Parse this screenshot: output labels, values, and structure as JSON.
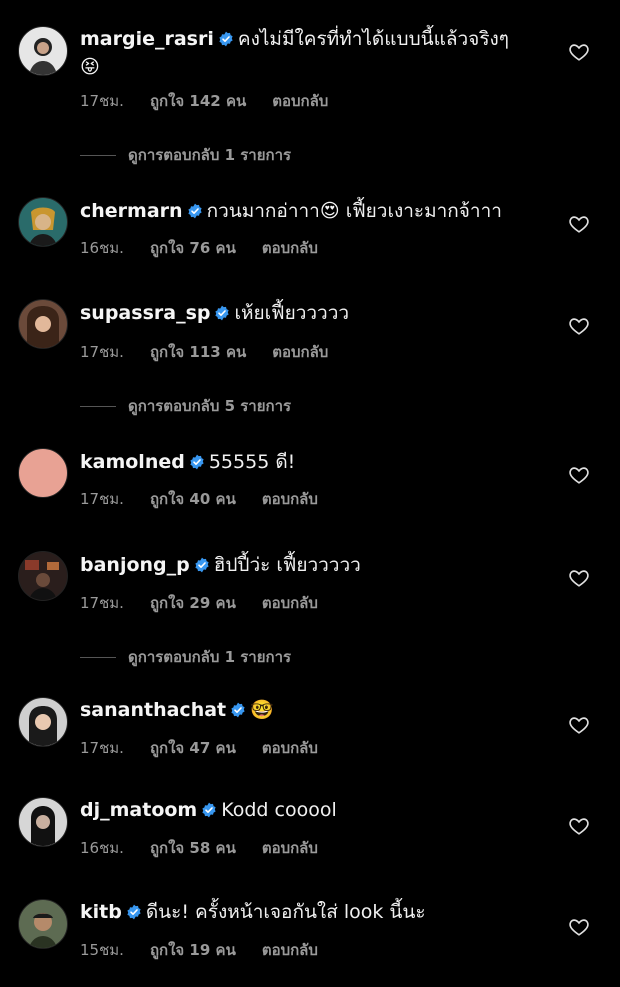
{
  "comments": [
    {
      "username": "margie_rasri",
      "text": "คงไม่มีใครที่ทำได้แบบนี้แล้วจริงๆ",
      "emoji": "😝",
      "time": "17ชม.",
      "likes": "ถูกใจ 142 คน",
      "reply": "ตอบกลับ",
      "avatar_color": "#d9d9d9"
    },
    {
      "username": "chermarn",
      "text": "กวนมากอ่าาา",
      "emoji": "😍",
      "text2": "เฟี้ยวเงาะมากจ้าาา",
      "time": "16ชม.",
      "likes": "ถูกใจ 76 คน",
      "reply": "ตอบกลับ",
      "avatar_color": "#2a6b6a"
    },
    {
      "username": "supassra_sp",
      "text": "เห้ยเฟี้ยววววว",
      "time": "17ชม.",
      "likes": "ถูกใจ 113 คน",
      "reply": "ตอบกลับ",
      "avatar_color": "#6b4a3a"
    },
    {
      "username": "kamolned",
      "text": "55555 ดี!",
      "time": "17ชม.",
      "likes": "ถูกใจ 40 คน",
      "reply": "ตอบกลับ",
      "avatar_color": "#e8a294"
    },
    {
      "username": "banjong_p",
      "text": "ฮิปปี้ว่ะ เฟี้ยววววว",
      "time": "17ชม.",
      "likes": "ถูกใจ 29 คน",
      "reply": "ตอบกลับ",
      "avatar_color": "#3a2a26"
    },
    {
      "username": "sananthachat",
      "text": "",
      "emoji": "🤓",
      "time": "17ชม.",
      "likes": "ถูกใจ 47 คน",
      "reply": "ตอบกลับ",
      "avatar_color": "#4a4a4a"
    },
    {
      "username": "dj_matoom",
      "text": "Kodd cooool",
      "time": "16ชม.",
      "likes": "ถูกใจ 58 คน",
      "reply": "ตอบกลับ",
      "avatar_color": "#2b2b2b"
    },
    {
      "username": "kitb",
      "text": "ดีนะ! ครั้งหน้าเจอกันใส่ look นี้นะ",
      "time": "15ชม.",
      "likes": "ถูกใจ 19 คน",
      "reply": "ตอบกลับ",
      "avatar_color": "#5d6b52"
    }
  ],
  "view_replies": [
    {
      "label": "ดูการตอบกลับ 1 รายการ"
    },
    {
      "label": "ดูการตอบกลับ 5 รายการ"
    },
    {
      "label": "ดูการตอบกลับ 1 รายการ"
    }
  ],
  "colors": {
    "verified": "#3897f0",
    "meta": "#9a9a9a",
    "background": "#000000"
  }
}
